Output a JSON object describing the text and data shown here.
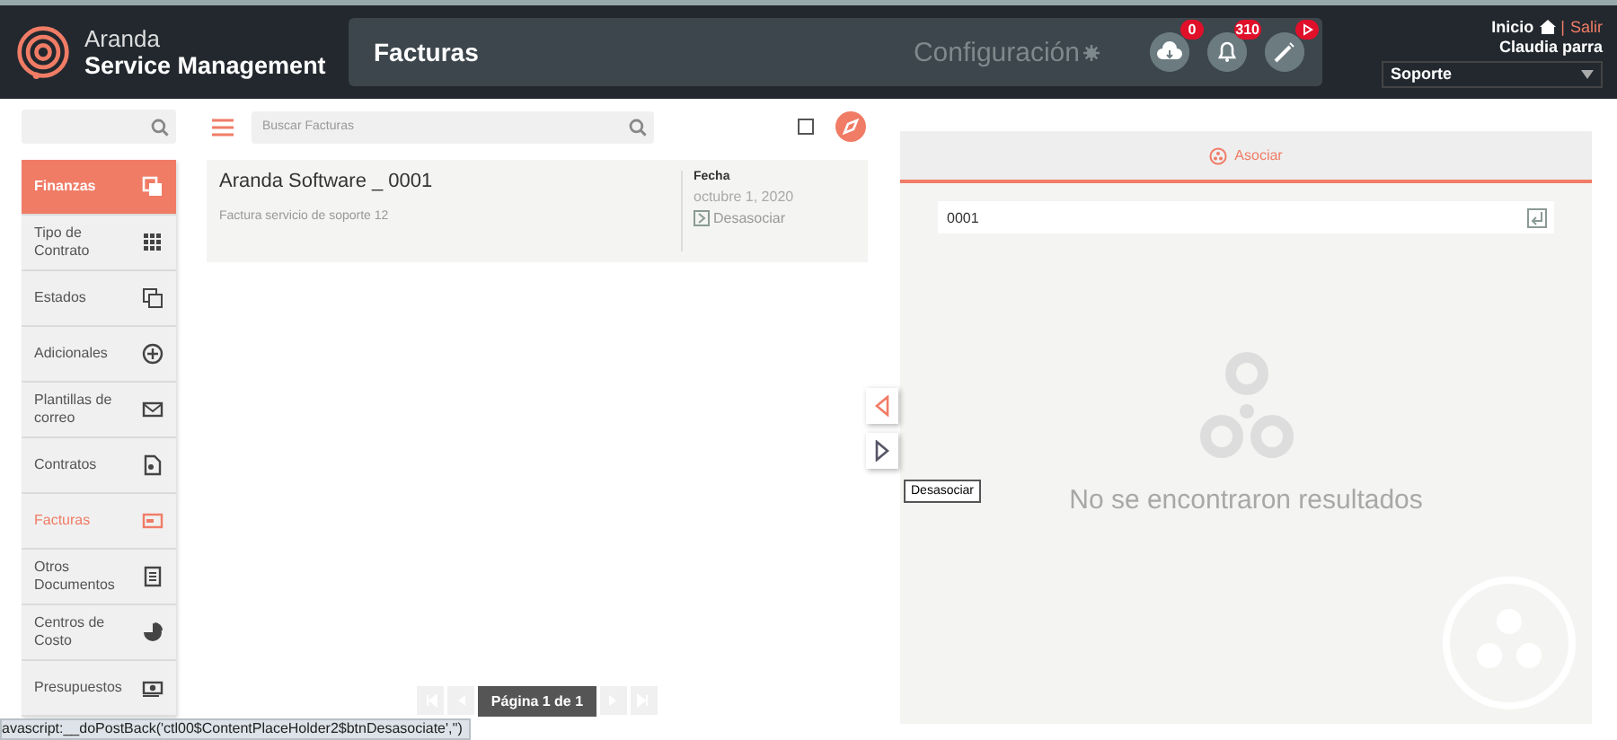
{
  "header": {
    "brand_top": "Aranda",
    "brand_bottom": "Service Management",
    "title": "Facturas",
    "config": "Configuración",
    "notifications": [
      {
        "kind": "cloud",
        "badge": "0"
      },
      {
        "kind": "bell",
        "badge": "310"
      },
      {
        "kind": "wand"
      }
    ],
    "home": "Inicio",
    "separator": "|",
    "logout": "Salir",
    "user": "Claudia parra",
    "role_select": "Soporte"
  },
  "sidebar": {
    "items": [
      {
        "label": "Finanzas",
        "kind": "section",
        "selected": false
      },
      {
        "label": "Tipo de Contrato",
        "kind": "item",
        "selected": false
      },
      {
        "label": "Estados",
        "kind": "item",
        "selected": false
      },
      {
        "label": "Adicionales",
        "kind": "item",
        "selected": false
      },
      {
        "label": "Plantillas de correo",
        "kind": "item",
        "selected": false
      },
      {
        "label": "Contratos",
        "kind": "item",
        "selected": false
      },
      {
        "label": "Facturas",
        "kind": "item",
        "selected": true
      },
      {
        "label": "Otros Documentos",
        "kind": "item",
        "selected": false
      },
      {
        "label": "Centros de Costo",
        "kind": "item",
        "selected": false
      },
      {
        "label": "Presupuestos",
        "kind": "item",
        "selected": false
      }
    ]
  },
  "list": {
    "search_placeholder": "Buscar Facturas",
    "select_all_checked": false,
    "cards": [
      {
        "title": "Aranda Software _ 0001",
        "description": "Factura servicio de soporte 12",
        "date_label": "Fecha",
        "date": "octubre 1, 2020",
        "action": "Desasociar"
      }
    ],
    "pager": {
      "label": "Página 1 de 1",
      "buttons": [
        {
          "kind": "first",
          "disabled": true
        },
        {
          "kind": "prev",
          "disabled": true
        },
        {
          "kind": "next",
          "disabled": true
        },
        {
          "kind": "last",
          "disabled": true
        }
      ]
    }
  },
  "tooltip": "Desasociar",
  "assoc_panel": {
    "tab": "Asociar",
    "search_value": "0001",
    "empty_text": "No se encontraron resultados"
  },
  "status_bar": "avascript:__doPostBack('ctl00$ContentPlaceHolder2$btnDesasociate','')"
}
